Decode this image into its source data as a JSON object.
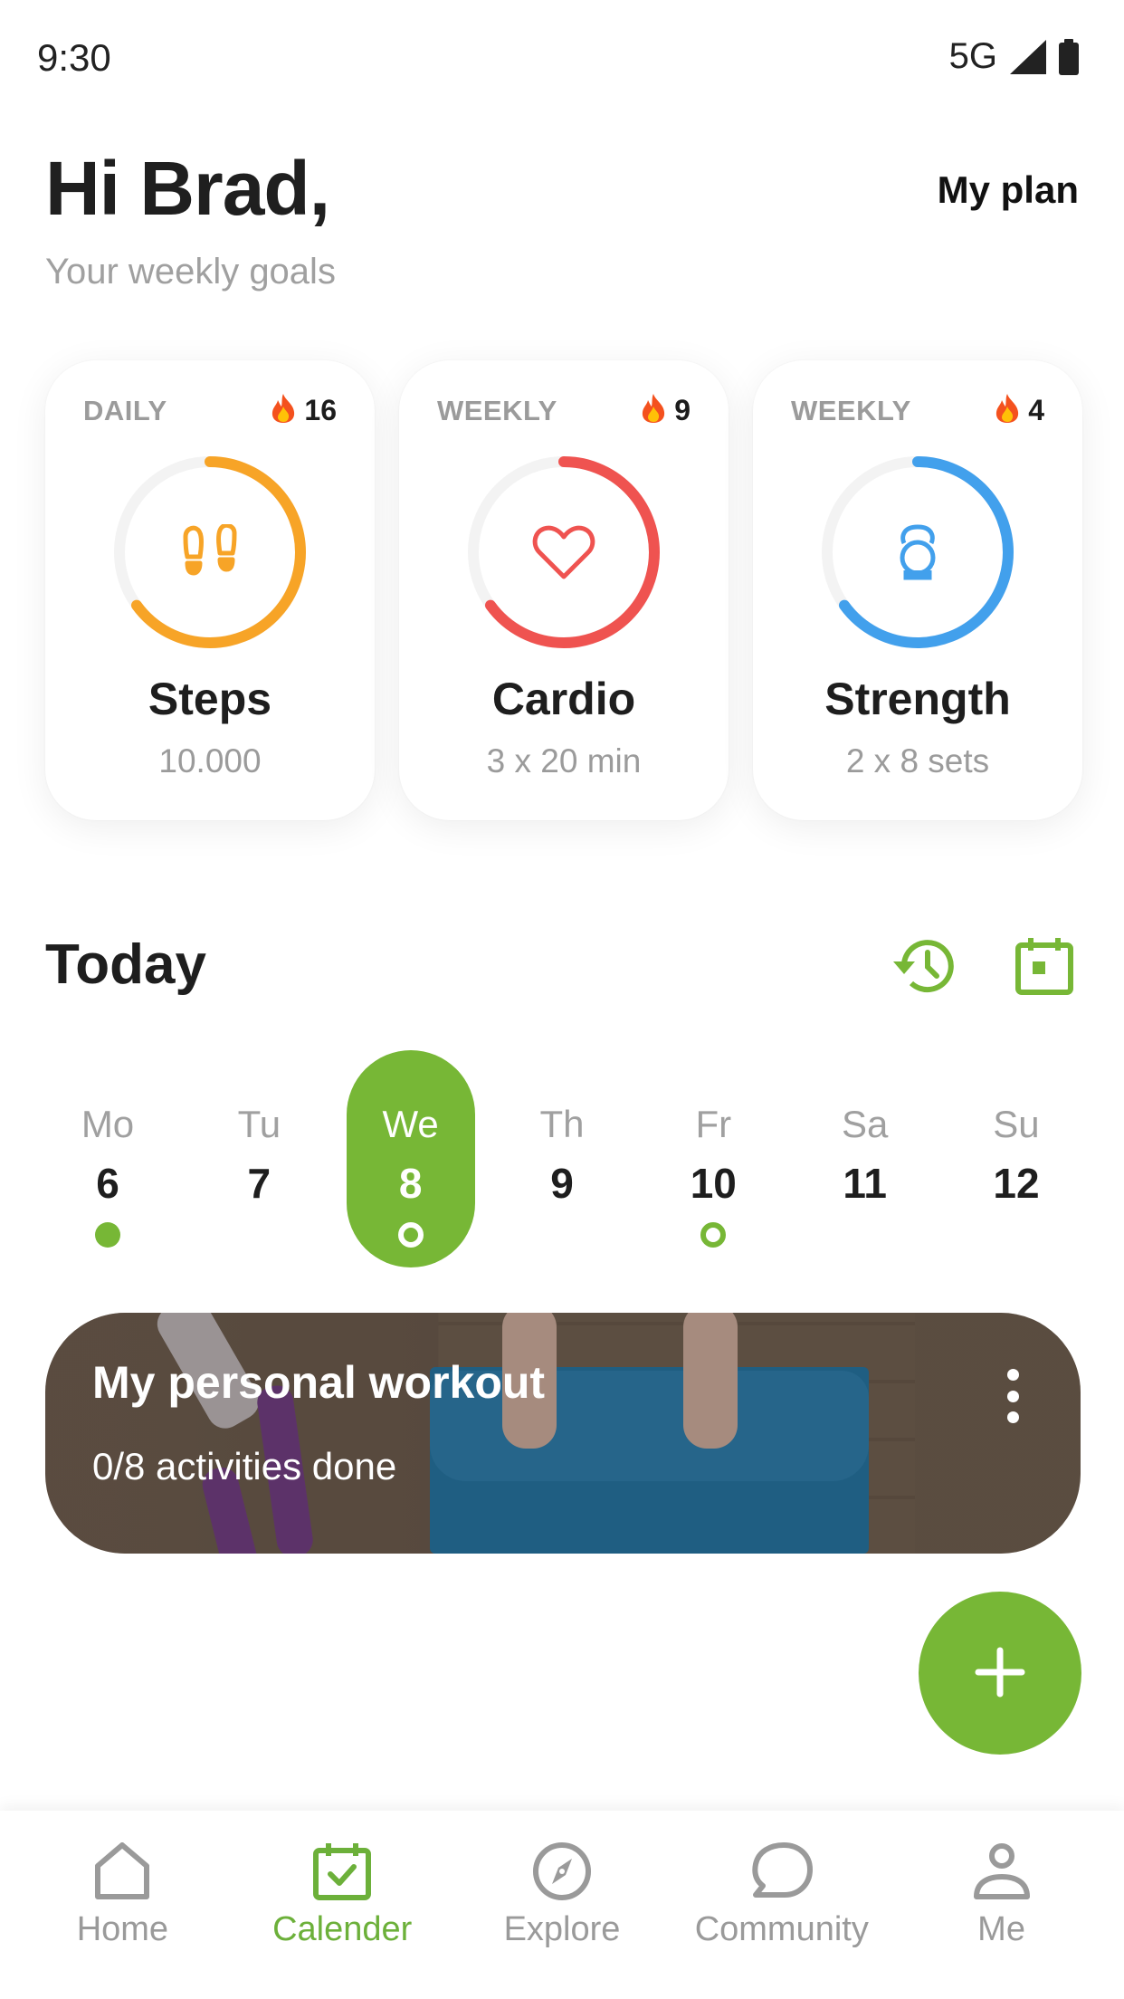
{
  "status_bar": {
    "time": "9:30",
    "network": "5G",
    "icons": [
      "signal-icon",
      "battery-icon"
    ]
  },
  "header": {
    "greeting": "Hi Brad,",
    "subtitle": "Your weekly goals",
    "my_plan_label": "My plan"
  },
  "goals": [
    {
      "period": "DAILY",
      "streak": "16",
      "streak_icon": "fire-icon",
      "icon": "footprints-icon",
      "name": "Steps",
      "target": "10.000",
      "progress": 0.65,
      "color": "#f7a427"
    },
    {
      "period": "WEEKLY",
      "streak": "9",
      "streak_icon": "fire-icon",
      "icon": "heart-icon",
      "name": "Cardio",
      "target": "3 x 20 min",
      "progress": 0.65,
      "color": "#ef5350"
    },
    {
      "period": "WEEKLY",
      "streak": "4",
      "streak_icon": "fire-icon",
      "icon": "kettlebell-icon",
      "name": "Strength",
      "target": "2 x 8 sets",
      "progress": 0.65,
      "color": "#42a0ec"
    }
  ],
  "today": {
    "title": "Today",
    "actions": [
      "history-icon",
      "calendar-icon"
    ]
  },
  "week": [
    {
      "name": "Mo",
      "num": "6",
      "marker": "filled",
      "selected": false
    },
    {
      "name": "Tu",
      "num": "7",
      "marker": "none",
      "selected": false
    },
    {
      "name": "We",
      "num": "8",
      "marker": "ring",
      "selected": true
    },
    {
      "name": "Th",
      "num": "9",
      "marker": "none",
      "selected": false
    },
    {
      "name": "Fr",
      "num": "10",
      "marker": "ring",
      "selected": false
    },
    {
      "name": "Sa",
      "num": "11",
      "marker": "none",
      "selected": false
    },
    {
      "name": "Su",
      "num": "12",
      "marker": "none",
      "selected": false
    }
  ],
  "workout": {
    "title": "My personal workout",
    "progress_text": "0/8 activities done"
  },
  "fab": {
    "icon": "plus-icon"
  },
  "bottom_nav": [
    {
      "label": "Home",
      "icon": "home-icon",
      "active": false
    },
    {
      "label": "Calender",
      "icon": "calendar-check-icon",
      "active": true
    },
    {
      "label": "Explore",
      "icon": "compass-icon",
      "active": false
    },
    {
      "label": "Community",
      "icon": "chat-bubble-icon",
      "active": false
    },
    {
      "label": "Me",
      "icon": "person-icon",
      "active": false
    }
  ],
  "colors": {
    "accent": "#77b736",
    "nav_active": "#6cb03a",
    "muted_text": "#9b9b9b",
    "ring_track": "#f3f3f3"
  }
}
